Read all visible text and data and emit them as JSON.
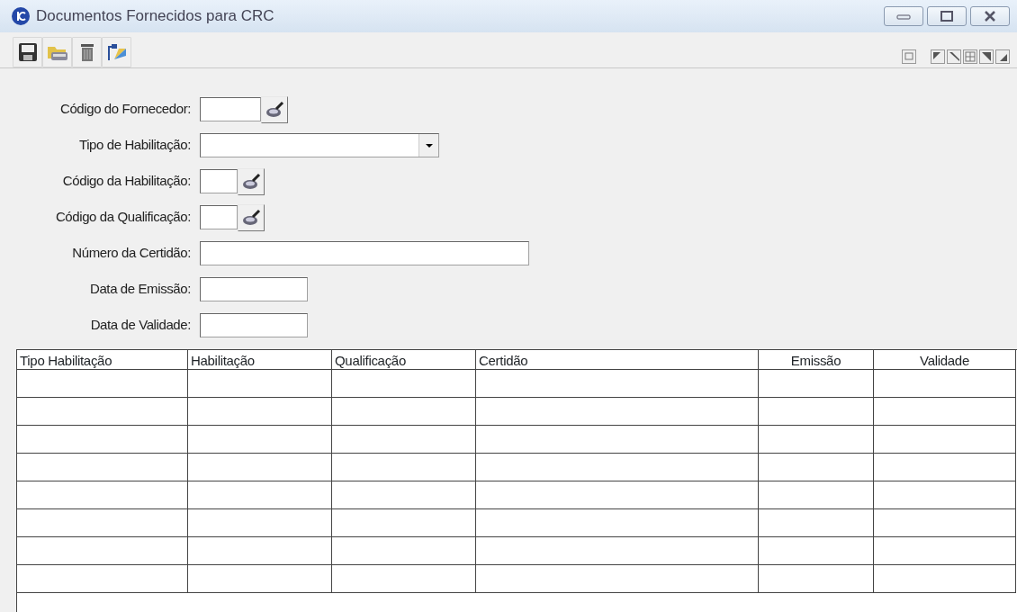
{
  "window": {
    "title": "Documentos Fornecidos para CRC"
  },
  "form": [
    {
      "label": "Código do Fornecedor:",
      "kind": "lookup"
    },
    {
      "label": "Tipo de Habilitação:",
      "kind": "combo"
    },
    {
      "label": "Código da Habilitação:",
      "kind": "lookup"
    },
    {
      "label": "Código da Qualificação:",
      "kind": "lookup"
    },
    {
      "label": "Número da Certidão:",
      "kind": "text"
    },
    {
      "label": "Data de Emissão:",
      "kind": "text"
    },
    {
      "label": "Data de Validade:",
      "kind": "text"
    }
  ],
  "table": {
    "columns": [
      {
        "label": "Tipo Habilitação",
        "kind": "text"
      },
      {
        "label": "Habilitação",
        "kind": "text"
      },
      {
        "label": "Qualificação",
        "kind": "text"
      },
      {
        "label": "Certidão",
        "kind": "text"
      },
      {
        "label": "Emissão",
        "kind": "date"
      },
      {
        "label": "Validade",
        "kind": "date"
      }
    ]
  }
}
